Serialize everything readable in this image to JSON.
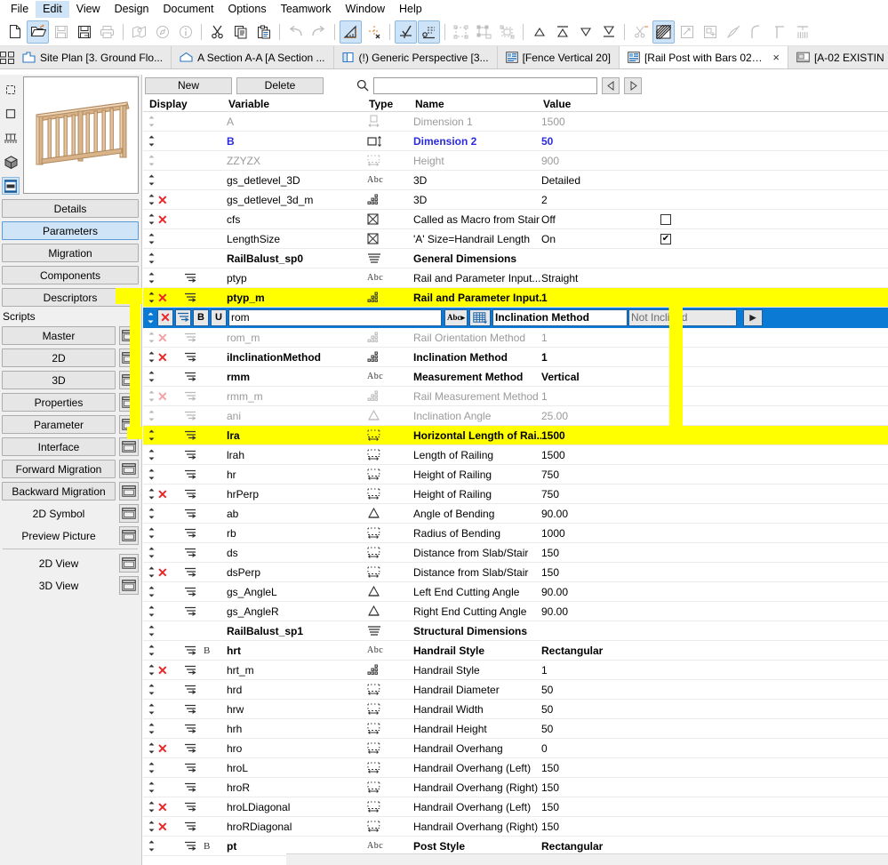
{
  "menu": {
    "items": [
      {
        "label": "File",
        "accel": "F",
        "active": false
      },
      {
        "label": "Edit",
        "accel": "E",
        "active": true
      },
      {
        "label": "View",
        "accel": "V",
        "active": false
      },
      {
        "label": "Design",
        "accel": "D",
        "active": false
      },
      {
        "label": "Document",
        "accel": "D",
        "active": false
      },
      {
        "label": "Options",
        "accel": "O",
        "active": false
      },
      {
        "label": "Teamwork",
        "accel": "T",
        "active": false
      },
      {
        "label": "Window",
        "accel": "W",
        "active": false
      },
      {
        "label": "Help",
        "accel": "H",
        "active": false
      }
    ]
  },
  "toolbar": {
    "buttons": [
      {
        "name": "new-file-icon",
        "enabled": true,
        "on": false
      },
      {
        "name": "open-file-icon",
        "enabled": true,
        "on": true
      },
      {
        "name": "save-icon",
        "enabled": false,
        "on": false
      },
      {
        "name": "save-as-icon",
        "enabled": true,
        "on": false
      },
      {
        "name": "print-icon",
        "enabled": false,
        "on": false
      },
      {
        "name": "separator"
      },
      {
        "name": "publish-icon",
        "enabled": false,
        "on": false
      },
      {
        "name": "navigator-icon",
        "enabled": false,
        "on": false
      },
      {
        "name": "info-icon",
        "enabled": false,
        "on": false
      },
      {
        "name": "separator"
      },
      {
        "name": "cut-icon",
        "enabled": true,
        "on": false
      },
      {
        "name": "copy-icon",
        "enabled": true,
        "on": false
      },
      {
        "name": "paste-icon",
        "enabled": true,
        "on": false
      },
      {
        "name": "separator"
      },
      {
        "name": "undo-icon",
        "enabled": false,
        "on": false
      },
      {
        "name": "redo-icon",
        "enabled": false,
        "on": false
      },
      {
        "name": "separator"
      },
      {
        "name": "measure-icon",
        "enabled": true,
        "on": true
      },
      {
        "name": "delete-point-icon",
        "enabled": true,
        "on": false
      },
      {
        "name": "separator"
      },
      {
        "name": "check-select-icon",
        "enabled": true,
        "on": true
      },
      {
        "name": "list-select-icon",
        "enabled": true,
        "on": true
      },
      {
        "name": "separator"
      },
      {
        "name": "group-icon",
        "enabled": false,
        "on": false
      },
      {
        "name": "ungroup-icon",
        "enabled": false,
        "on": false
      },
      {
        "name": "suspend-groups-icon",
        "enabled": false,
        "on": false
      },
      {
        "name": "separator"
      },
      {
        "name": "bring-forward-icon",
        "enabled": true,
        "on": false
      },
      {
        "name": "bring-to-front-icon",
        "enabled": true,
        "on": false
      },
      {
        "name": "send-backward-icon",
        "enabled": true,
        "on": false
      },
      {
        "name": "send-to-back-icon",
        "enabled": true,
        "on": false
      },
      {
        "name": "separator"
      },
      {
        "name": "trim-icon",
        "enabled": false,
        "on": false
      },
      {
        "name": "fill-pattern-icon",
        "enabled": true,
        "on": true
      },
      {
        "name": "offset-icon",
        "enabled": false,
        "on": false
      },
      {
        "name": "multiply-icon",
        "enabled": false,
        "on": false
      },
      {
        "name": "magic-wand-icon",
        "enabled": false,
        "on": false
      },
      {
        "name": "fillet-icon",
        "enabled": false,
        "on": false
      },
      {
        "name": "intersect-icon",
        "enabled": false,
        "on": false
      },
      {
        "name": "split-icon",
        "enabled": false,
        "on": false
      }
    ]
  },
  "tabs": [
    {
      "label": "Site Plan [3. Ground Flo...",
      "icon": "site-plan-icon",
      "active": false,
      "closable": false
    },
    {
      "label": "A Section A-A [A Section ...",
      "icon": "section-icon",
      "active": false,
      "closable": false
    },
    {
      "label": "(!) Generic Perspective [3...",
      "icon": "perspective-icon",
      "active": false,
      "closable": false
    },
    {
      "label": "[Fence Vertical 20]",
      "icon": "gdl-object-icon",
      "active": false,
      "closable": false
    },
    {
      "label": "[Rail Post with Bars 02 20]",
      "icon": "gdl-object-icon",
      "active": true,
      "closable": true,
      "close_glyph": "×"
    },
    {
      "label": "[A-02 EXISTIN",
      "icon": "layout-icon",
      "active": false,
      "closable": false
    }
  ],
  "left_panel": {
    "icon_strip": [
      {
        "name": "object-subtype-icon",
        "selected": false
      },
      {
        "name": "rectangle-subtype-icon",
        "selected": false
      },
      {
        "name": "railing-subtype-icon",
        "selected": false
      },
      {
        "name": "cube-subtype-icon",
        "selected": false
      },
      {
        "name": "railing-element-icon",
        "selected": true
      }
    ],
    "preview_alt": "Railing 3D preview",
    "buttons": [
      {
        "label": "Details",
        "selected": false
      },
      {
        "label": "Parameters",
        "selected": true
      },
      {
        "label": "Migration",
        "selected": false
      },
      {
        "label": "Components",
        "selected": false
      },
      {
        "label": "Descriptors",
        "selected": false
      }
    ],
    "scripts_label": "Scripts",
    "script_buttons": [
      {
        "label": "Master",
        "editor": true
      },
      {
        "label": "2D",
        "editor": true
      },
      {
        "label": "3D",
        "editor": true
      },
      {
        "label": "Properties",
        "editor": true
      },
      {
        "label": "Parameter",
        "editor": true
      },
      {
        "label": "Interface",
        "editor": true
      },
      {
        "label": "Forward Migration",
        "editor": true
      },
      {
        "label": "Backward Migration",
        "editor": true
      },
      {
        "label": "2D Symbol",
        "editor": true,
        "flat": true
      },
      {
        "label": "Preview Picture",
        "editor": true,
        "flat": true
      }
    ],
    "view_buttons": [
      {
        "label": "2D View",
        "editor": true,
        "flat": true
      },
      {
        "label": "3D View",
        "editor": true,
        "flat": true
      }
    ]
  },
  "table_toolbar": {
    "new_label": "New",
    "delete_label": "Delete",
    "search_icon": "search-icon",
    "search_value": "",
    "search_placeholder": "",
    "prev_label": "◁",
    "next_label": "▷"
  },
  "table": {
    "headers": [
      "Display",
      "Variable",
      "Type",
      "Name",
      "Value"
    ],
    "selected_row": {
      "variable": "rom",
      "name": "Inclination Method",
      "value": "Not Inclined",
      "type_icon": "text-type-icon",
      "list_icon": "value-list-icon",
      "bold_btn": "B",
      "underline_btn": "U",
      "x_btn": "delete-parameter-icon",
      "indent_btn": "indent-icon",
      "popup_btn": "▶"
    },
    "rows": [
      {
        "var": "A",
        "type": "dim-horizontal-icon",
        "name": "Dimension 1",
        "value": "1500",
        "dim": true,
        "x": false,
        "bold": false,
        "indent": false,
        "blue": false,
        "check": null,
        "hl": false
      },
      {
        "var": "B",
        "type": "dim-vertical-icon",
        "name": "Dimension 2",
        "value": "50",
        "dim": false,
        "x": false,
        "bold": true,
        "indent": false,
        "blue": true,
        "check": null,
        "hl": false
      },
      {
        "var": "ZZYZX",
        "type": "length-icon",
        "name": "Height",
        "value": "900",
        "dim": true,
        "x": false,
        "bold": false,
        "indent": false,
        "blue": false,
        "check": null,
        "hl": false
      },
      {
        "var": "gs_detlevel_3D",
        "type": "text-type-icon",
        "name": "3D",
        "value": "Detailed",
        "dim": false,
        "x": false,
        "bold": false,
        "indent": false,
        "blue": false,
        "check": null,
        "hl": false
      },
      {
        "var": "gs_detlevel_3d_m",
        "type": "integer-icon",
        "name": "3D",
        "value": "2",
        "dim": false,
        "x": true,
        "bold": false,
        "indent": false,
        "blue": false,
        "check": null,
        "hl": false
      },
      {
        "var": "cfs",
        "type": "boolean-icon",
        "name": "Called as Macro from Stair",
        "value": "Off",
        "dim": false,
        "x": true,
        "bold": false,
        "indent": false,
        "blue": false,
        "check": "off",
        "hl": false
      },
      {
        "var": "LengthSize",
        "type": "boolean-icon",
        "name": "'A' Size=Handrail Length",
        "value": "On",
        "dim": false,
        "x": false,
        "bold": false,
        "indent": false,
        "blue": false,
        "check": "on",
        "hl": false
      },
      {
        "var": "RailBalust_sp0",
        "type": "title-icon",
        "name": "General Dimensions",
        "value": "",
        "dim": false,
        "x": false,
        "bold": true,
        "indent": false,
        "blue": false,
        "check": null,
        "hl": false
      },
      {
        "var": "ptyp",
        "type": "text-type-icon",
        "name": "Rail and Parameter Input...",
        "value": "Straight",
        "dim": false,
        "x": false,
        "bold": false,
        "indent": true,
        "blue": false,
        "check": null,
        "hl": false
      },
      {
        "var": "ptyp_m",
        "type": "integer-icon",
        "name": "Rail and Parameter Input...",
        "value": "1",
        "dim": false,
        "x": true,
        "bold": true,
        "indent": true,
        "blue": false,
        "check": null,
        "hl": true
      },
      {
        "var": "rom_m",
        "type": "integer-icon",
        "name": "Rail Orientation Method",
        "value": "1",
        "dim": true,
        "x": true,
        "bold": false,
        "indent": true,
        "blue": false,
        "check": null,
        "hl": false
      },
      {
        "var": "iInclinationMethod",
        "type": "integer-icon",
        "name": "Inclination Method",
        "value": "1",
        "dim": false,
        "x": true,
        "bold": true,
        "indent": true,
        "blue": false,
        "check": null,
        "hl": false
      },
      {
        "var": "rmm",
        "type": "text-type-icon",
        "name": "Measurement Method",
        "value": "Vertical",
        "dim": false,
        "x": false,
        "bold": true,
        "indent": true,
        "blue": false,
        "check": null,
        "hl": false
      },
      {
        "var": "rmm_m",
        "type": "integer-icon",
        "name": "Rail Measurement Method",
        "value": "1",
        "dim": true,
        "x": true,
        "bold": false,
        "indent": true,
        "blue": false,
        "check": null,
        "hl": false
      },
      {
        "var": "ani",
        "type": "angle-icon",
        "name": "Inclination Angle",
        "value": "25.00",
        "dim": true,
        "x": false,
        "bold": false,
        "indent": true,
        "blue": false,
        "check": null,
        "hl": false
      },
      {
        "var": "lra",
        "type": "length-icon",
        "name": "Horizontal Length of Rai...",
        "value": "1500",
        "dim": false,
        "x": false,
        "bold": true,
        "indent": true,
        "blue": false,
        "check": null,
        "hl": true
      },
      {
        "var": "lrah",
        "type": "length-icon",
        "name": "Length of Railing",
        "value": "1500",
        "dim": false,
        "x": false,
        "bold": false,
        "indent": true,
        "blue": false,
        "check": null,
        "hl": false
      },
      {
        "var": "hr",
        "type": "length-icon",
        "name": "Height of Railing",
        "value": "750",
        "dim": false,
        "x": false,
        "bold": false,
        "indent": true,
        "blue": false,
        "check": null,
        "hl": false
      },
      {
        "var": "hrPerp",
        "type": "length-icon",
        "name": "Height of Railing",
        "value": "750",
        "dim": false,
        "x": true,
        "bold": false,
        "indent": true,
        "blue": false,
        "check": null,
        "hl": false
      },
      {
        "var": "ab",
        "type": "angle-icon",
        "name": "Angle of Bending",
        "value": "90.00",
        "dim": false,
        "x": false,
        "bold": false,
        "indent": true,
        "blue": false,
        "check": null,
        "hl": false
      },
      {
        "var": "rb",
        "type": "length-icon",
        "name": "Radius of Bending",
        "value": "1000",
        "dim": false,
        "x": false,
        "bold": false,
        "indent": true,
        "blue": false,
        "check": null,
        "hl": false
      },
      {
        "var": "ds",
        "type": "length-icon",
        "name": "Distance from Slab/Stair",
        "value": "150",
        "dim": false,
        "x": false,
        "bold": false,
        "indent": true,
        "blue": false,
        "check": null,
        "hl": false
      },
      {
        "var": "dsPerp",
        "type": "length-icon",
        "name": "Distance from Slab/Stair",
        "value": "150",
        "dim": false,
        "x": true,
        "bold": false,
        "indent": true,
        "blue": false,
        "check": null,
        "hl": false
      },
      {
        "var": "gs_AngleL",
        "type": "angle-icon",
        "name": "Left End Cutting Angle",
        "value": "90.00",
        "dim": false,
        "x": false,
        "bold": false,
        "indent": true,
        "blue": false,
        "check": null,
        "hl": false
      },
      {
        "var": "gs_AngleR",
        "type": "angle-icon",
        "name": "Right End Cutting Angle",
        "value": "90.00",
        "dim": false,
        "x": false,
        "bold": false,
        "indent": true,
        "blue": false,
        "check": null,
        "hl": false
      },
      {
        "var": "RailBalust_sp1",
        "type": "title-icon",
        "name": "Structural Dimensions",
        "value": "",
        "dim": false,
        "x": false,
        "bold": true,
        "indent": false,
        "blue": false,
        "check": null,
        "hl": false
      },
      {
        "var": "hrt",
        "type": "text-type-icon",
        "name": "Handrail Style",
        "value": "Rectangular",
        "dim": false,
        "x": false,
        "bold": true,
        "indent": true,
        "blue": false,
        "check": null,
        "hl": false,
        "bflag": "B"
      },
      {
        "var": "hrt_m",
        "type": "integer-icon",
        "name": "Handrail Style",
        "value": "1",
        "dim": false,
        "x": true,
        "bold": false,
        "indent": true,
        "blue": false,
        "check": null,
        "hl": false
      },
      {
        "var": "hrd",
        "type": "length-icon",
        "name": "Handrail Diameter",
        "value": "50",
        "dim": false,
        "x": false,
        "bold": false,
        "indent": true,
        "blue": false,
        "check": null,
        "hl": false
      },
      {
        "var": "hrw",
        "type": "length-icon",
        "name": "Handrail Width",
        "value": "50",
        "dim": false,
        "x": false,
        "bold": false,
        "indent": true,
        "blue": false,
        "check": null,
        "hl": false
      },
      {
        "var": "hrh",
        "type": "length-icon",
        "name": "Handrail Height",
        "value": "50",
        "dim": false,
        "x": false,
        "bold": false,
        "indent": true,
        "blue": false,
        "check": null,
        "hl": false
      },
      {
        "var": "hro",
        "type": "length-icon",
        "name": "Handrail Overhang",
        "value": "0",
        "dim": false,
        "x": true,
        "bold": false,
        "indent": true,
        "blue": false,
        "check": null,
        "hl": false
      },
      {
        "var": "hroL",
        "type": "length-icon",
        "name": "Handrail Overhang (Left)",
        "value": "150",
        "dim": false,
        "x": false,
        "bold": false,
        "indent": true,
        "blue": false,
        "check": null,
        "hl": false
      },
      {
        "var": "hroR",
        "type": "length-icon",
        "name": "Handrail Overhang (Right)",
        "value": "150",
        "dim": false,
        "x": false,
        "bold": false,
        "indent": true,
        "blue": false,
        "check": null,
        "hl": false
      },
      {
        "var": "hroLDiagonal",
        "type": "length-icon",
        "name": "Handrail Overhang (Left)",
        "value": "150",
        "dim": false,
        "x": true,
        "bold": false,
        "indent": true,
        "blue": false,
        "check": null,
        "hl": false
      },
      {
        "var": "hroRDiagonal",
        "type": "length-icon",
        "name": "Handrail Overhang (Right)",
        "value": "150",
        "dim": false,
        "x": true,
        "bold": false,
        "indent": true,
        "blue": false,
        "check": null,
        "hl": false
      },
      {
        "var": "pt",
        "type": "text-type-icon",
        "name": "Post Style",
        "value": "Rectangular",
        "dim": false,
        "x": false,
        "bold": true,
        "indent": true,
        "blue": false,
        "check": null,
        "hl": false,
        "bflag": "B"
      }
    ]
  },
  "colors": {
    "selection_blue": "#0a7ad4",
    "marker_yellow": "#ffff00",
    "error_red": "#e8262a",
    "link_blue": "#2b2bdd",
    "panel_gray": "#f0f0f0",
    "button_gray": "#e6e6e6",
    "highlight_light_blue": "#cde3f7"
  }
}
